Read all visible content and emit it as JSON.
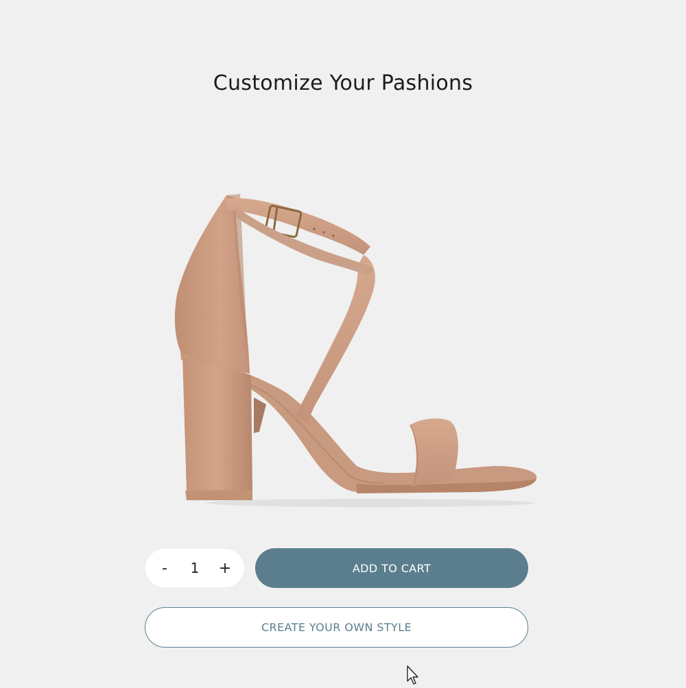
{
  "page": {
    "title": "Customize Your Pashions"
  },
  "product": {
    "image_icon": "strappy-block-heel-sandal",
    "color": "#c99a80"
  },
  "quantity": {
    "decrement_label": "-",
    "value": "1",
    "increment_label": "+"
  },
  "actions": {
    "add_to_cart_label": "ADD TO CART",
    "create_style_label": "CREATE YOUR OWN STYLE"
  },
  "colors": {
    "accent": "#5a7e8d",
    "background": "#f0f0f0"
  }
}
